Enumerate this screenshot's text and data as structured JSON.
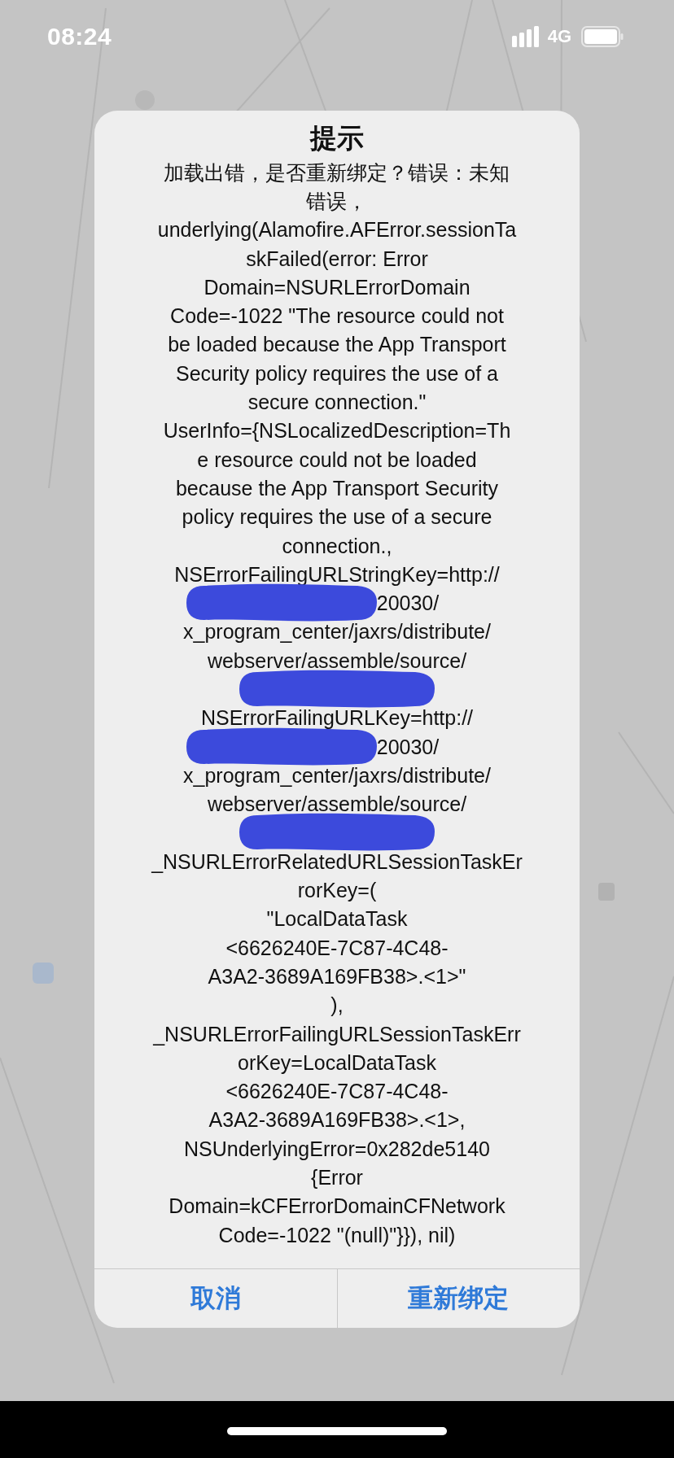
{
  "status_bar": {
    "time": "08:24",
    "network": "4G"
  },
  "alert": {
    "title": "提示",
    "message_lines": [
      {
        "kind": "text",
        "text": "加载出错，是否重新绑定？错误：未知"
      },
      {
        "kind": "text",
        "text": "错误，"
      },
      {
        "kind": "text",
        "text": "underlying(Alamofire.AFError.sessionTa"
      },
      {
        "kind": "text",
        "text": "skFailed(error: Error"
      },
      {
        "kind": "text",
        "text": "Domain=NSURLErrorDomain"
      },
      {
        "kind": "text",
        "text": "Code=-1022 \"The resource could not"
      },
      {
        "kind": "text",
        "text": "be loaded because the App Transport"
      },
      {
        "kind": "text",
        "text": "Security policy requires the use of a"
      },
      {
        "kind": "text",
        "text": "secure connection.\""
      },
      {
        "kind": "text",
        "text": "UserInfo={NSLocalizedDescription=Th"
      },
      {
        "kind": "text",
        "text": "e resource could not be loaded"
      },
      {
        "kind": "text",
        "text": "because the App Transport Security"
      },
      {
        "kind": "text",
        "text": "policy requires the use of a secure"
      },
      {
        "kind": "text",
        "text": "connection.,"
      },
      {
        "kind": "text",
        "text": "NSErrorFailingURLStringKey=http://"
      },
      {
        "kind": "redacted",
        "text": "20030/"
      },
      {
        "kind": "text",
        "text": "x_program_center/jaxrs/distribute/"
      },
      {
        "kind": "text",
        "text": "webserver/assemble/source/"
      },
      {
        "kind": "redacted"
      },
      {
        "kind": "text",
        "text": "NSErrorFailingURLKey=http://"
      },
      {
        "kind": "redacted",
        "text": "20030/"
      },
      {
        "kind": "text",
        "text": "x_program_center/jaxrs/distribute/"
      },
      {
        "kind": "text",
        "text": "webserver/assemble/source/"
      },
      {
        "kind": "redacted"
      },
      {
        "kind": "text",
        "text": "_NSURLErrorRelatedURLSessionTaskEr"
      },
      {
        "kind": "text",
        "text": "rorKey=("
      },
      {
        "kind": "text",
        "text": "\"LocalDataTask"
      },
      {
        "kind": "text",
        "text": "<6626240E-7C87-4C48-"
      },
      {
        "kind": "text",
        "text": "A3A2-3689A169FB38>.<1>\""
      },
      {
        "kind": "text",
        "text": "),"
      },
      {
        "kind": "text",
        "text": "_NSURLErrorFailingURLSessionTaskErr"
      },
      {
        "kind": "text",
        "text": "orKey=LocalDataTask"
      },
      {
        "kind": "text",
        "text": "<6626240E-7C87-4C48-"
      },
      {
        "kind": "text",
        "text": "A3A2-3689A169FB38>.<1>,"
      },
      {
        "kind": "text",
        "text": "NSUnderlyingError=0x282de5140"
      },
      {
        "kind": "text",
        "text": "{Error"
      },
      {
        "kind": "text",
        "text": "Domain=kCFErrorDomainCFNetwork"
      },
      {
        "kind": "text",
        "text": "Code=-1022 \"(null)\"}}), nil)"
      }
    ],
    "buttons": [
      {
        "label": "取消"
      },
      {
        "label": "重新绑定"
      }
    ]
  }
}
